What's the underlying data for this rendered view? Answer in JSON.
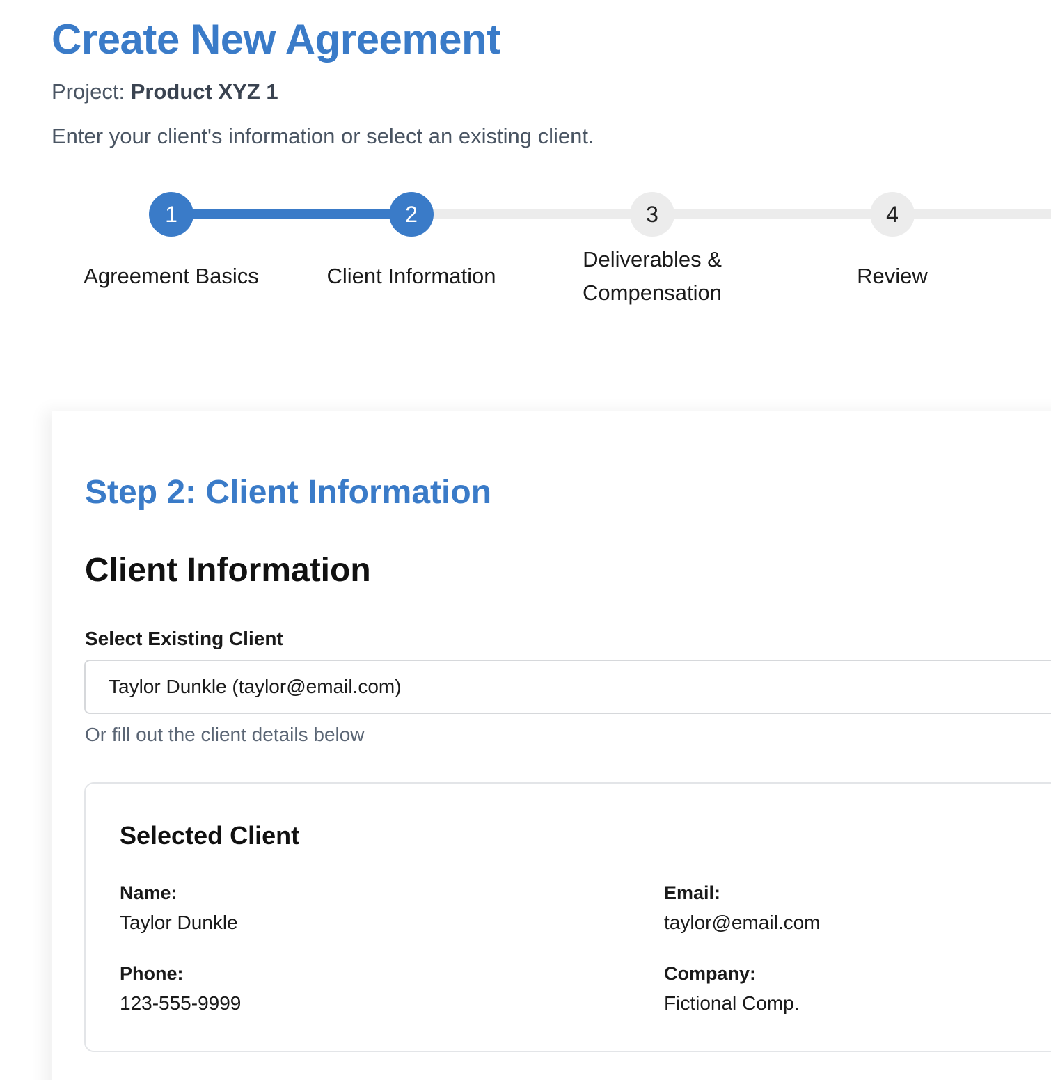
{
  "header": {
    "title": "Create New Agreement",
    "project_prefix": "Project:",
    "project_name": "Product XYZ 1",
    "intro": "Enter your client's information or select an existing client."
  },
  "stepper": {
    "steps": [
      {
        "number": "1",
        "label": "Agreement Basics",
        "state": "completed"
      },
      {
        "number": "2",
        "label": "Client Information",
        "state": "active"
      },
      {
        "number": "3",
        "label": "Deliverables & Compensation",
        "state": "pending"
      },
      {
        "number": "4",
        "label": "Review",
        "state": "pending"
      }
    ]
  },
  "form": {
    "step_heading": "Step 2: Client Information",
    "section_heading": "Client Information",
    "select_label": "Select Existing Client",
    "selected_value": "Taylor Dunkle (taylor@email.com)",
    "helper": "Or fill out the client details below"
  },
  "selected_client": {
    "title": "Selected Client",
    "name_label": "Name:",
    "name": "Taylor Dunkle",
    "email_label": "Email:",
    "email": "taylor@email.com",
    "phone_label": "Phone:",
    "phone": "123-555-9999",
    "company_label": "Company:",
    "company": "Fictional Comp."
  },
  "colors": {
    "accent": "#3a7bc8",
    "inactive": "#ececec"
  }
}
